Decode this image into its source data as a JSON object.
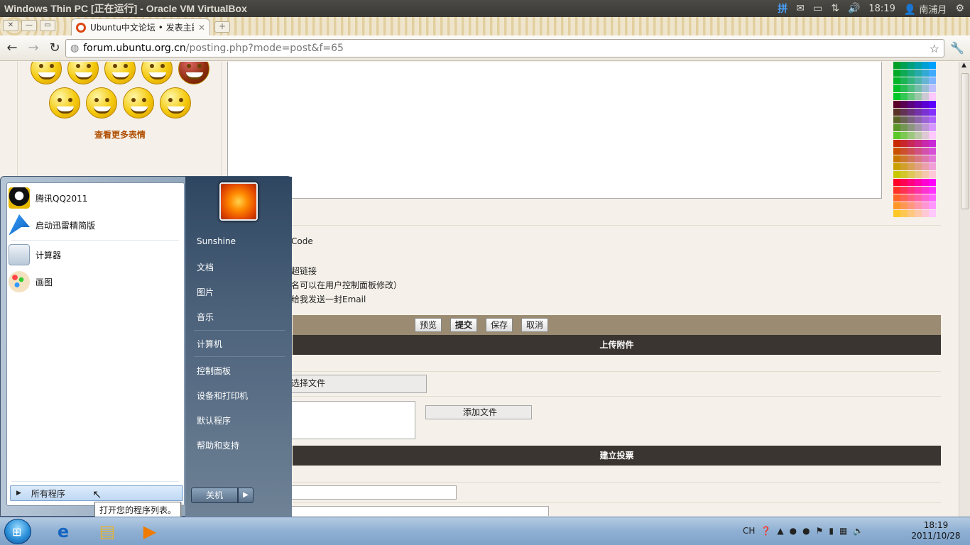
{
  "ubuntu_bar": {
    "window_title": "Windows Thin PC [正在运行] - Oracle VM VirtualBox",
    "time": "18:19",
    "user": "南浦月",
    "ime_glyph": "拼"
  },
  "browser": {
    "tab_title": "Ubuntu中文论坛 • 发表主题",
    "url_host": "forum.ubuntu.org.cn",
    "url_path": "/posting.php?mode=post&f=65"
  },
  "page": {
    "more_smilies": "查看更多表情",
    "options": [
      "Code",
      "超链接",
      "名可以在用户控制面板修改）",
      "给我发送一封Email"
    ],
    "buttons": {
      "preview": "预览",
      "submit": "提交",
      "save": "保存",
      "cancel": "取消"
    },
    "upload_header": "上传附件",
    "choose_file": "选择文件",
    "add_file": "添加文件",
    "poll_header": "建立投票"
  },
  "start_menu": {
    "pinned": [
      {
        "label": "腾讯QQ2011"
      },
      {
        "label": "启动迅雷精简版"
      },
      {
        "label": "计算器"
      },
      {
        "label": "画图"
      }
    ],
    "right_items": [
      "Sunshine",
      "文档",
      "图片",
      "音乐",
      "计算机",
      "控制面板",
      "设备和打印机",
      "默认程序",
      "帮助和支持"
    ],
    "all_programs": "所有程序",
    "shutdown": "关机",
    "tooltip": "打开您的程序列表。"
  },
  "taskbar": {
    "lang": "CH",
    "time": "18:19",
    "date": "2011/10/28"
  }
}
